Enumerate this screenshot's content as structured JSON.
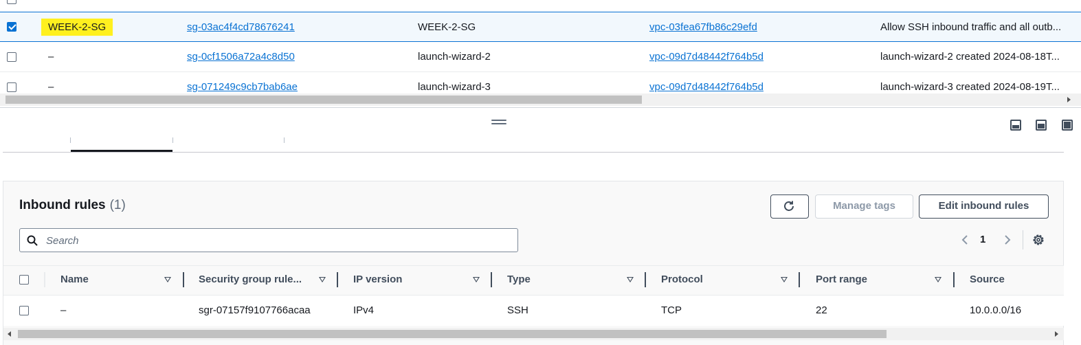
{
  "security_groups": {
    "rows": [
      {
        "checked": true,
        "name": "WEEK-2-SG",
        "id": "sg-03ac4f4cd78676241",
        "group_name": "WEEK-2-SG",
        "vpc": "vpc-03fea67fb86c29efd",
        "description": "Allow SSH inbound traffic and all outb..."
      },
      {
        "checked": false,
        "name": "–",
        "id": "sg-0cf1506a72a4c8d50",
        "group_name": "launch-wizard-2",
        "vpc": "vpc-09d7d48442f764b5d",
        "description": "launch-wizard-2 created 2024-08-18T..."
      },
      {
        "checked": false,
        "name": "–",
        "id": "sg-071249c9cb7bab6ae",
        "group_name": "launch-wizard-3",
        "vpc": "vpc-09d7d48442f764b5d",
        "description": "launch-wizard-3 created 2024-08-19T..."
      }
    ]
  },
  "pane_controls": {
    "icons": [
      "drag-handle-icon",
      "split-bottom-icon",
      "split-side-icon",
      "fullscreen-icon"
    ]
  },
  "inbound": {
    "title": "Inbound rules",
    "count": "(1)",
    "refresh_icon": "refresh-icon",
    "manage_tags": "Manage tags",
    "edit_rules": "Edit inbound rules",
    "search_placeholder": "Search",
    "page": "1",
    "columns": [
      "Name",
      "Security group rule...",
      "IP version",
      "Type",
      "Protocol",
      "Port range",
      "Source"
    ],
    "rows": [
      {
        "name": "–",
        "rule_id": "sgr-07157f9107766acaa",
        "ip_version": "IPv4",
        "type": "SSH",
        "protocol": "TCP",
        "port_range": "22",
        "source": "10.0.0.0/16"
      }
    ]
  },
  "colors": {
    "link": "#0972d3",
    "highlight": "#fff01f",
    "selected_row": "#f2f8fd"
  }
}
